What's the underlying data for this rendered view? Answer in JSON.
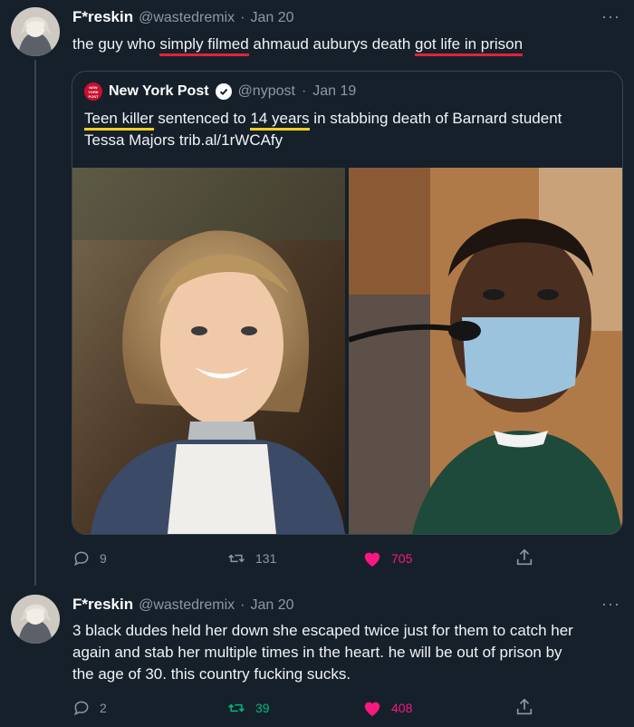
{
  "tweet1": {
    "display_name": "F*reskin",
    "handle": "@wastedremix",
    "date": "Jan 20",
    "text_parts": [
      "the guy who ",
      "simply filmed",
      " ahmaud auburys death ",
      "got life in prison"
    ],
    "more": "···"
  },
  "quote": {
    "logo_text": "NEW YORK POST",
    "display_name": "New York Post",
    "handle": "@nypost",
    "date": "Jan 19",
    "text_parts": [
      "Teen killer",
      " sentenced to ",
      "14 years",
      " in stabbing death of Barnard student",
      "Tessa Majors trib.al/1rWCAfy"
    ]
  },
  "tweet1_actions": {
    "replies": "9",
    "retweets": "131",
    "likes": "705"
  },
  "tweet2": {
    "display_name": "F*reskin",
    "handle": "@wastedremix",
    "date": "Jan 20",
    "lines": [
      "3 black dudes held her down she escaped twice just for them to catch her",
      "again and stab her multiple times in the heart. he will be out of prison by",
      "the age of 30. this country fucking sucks."
    ],
    "more": "···"
  },
  "tweet2_actions": {
    "replies": "2",
    "retweets": "39",
    "likes": "408"
  },
  "colors": {
    "background": "#15202b",
    "like": "#f91880",
    "retweet": "#00ba7c",
    "annotation_red": "#e0243a",
    "annotation_yellow": "#f3d01d"
  }
}
